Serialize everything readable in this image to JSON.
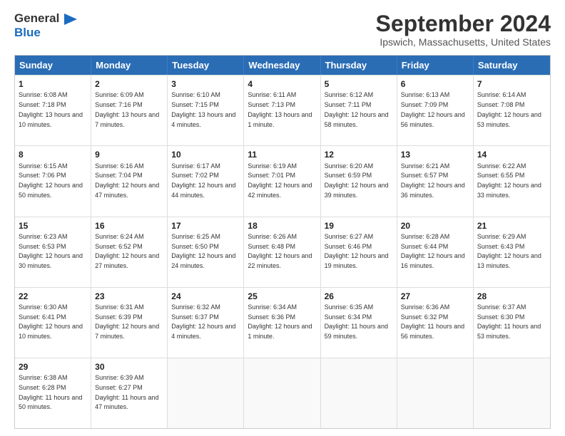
{
  "logo": {
    "line1": "General",
    "line2": "Blue"
  },
  "title": "September 2024",
  "subtitle": "Ipswich, Massachusetts, United States",
  "days": [
    "Sunday",
    "Monday",
    "Tuesday",
    "Wednesday",
    "Thursday",
    "Friday",
    "Saturday"
  ],
  "weeks": [
    [
      {
        "day": "1",
        "sunrise": "6:08 AM",
        "sunset": "7:18 PM",
        "daylight": "13 hours and 10 minutes."
      },
      {
        "day": "2",
        "sunrise": "6:09 AM",
        "sunset": "7:16 PM",
        "daylight": "13 hours and 7 minutes."
      },
      {
        "day": "3",
        "sunrise": "6:10 AM",
        "sunset": "7:15 PM",
        "daylight": "13 hours and 4 minutes."
      },
      {
        "day": "4",
        "sunrise": "6:11 AM",
        "sunset": "7:13 PM",
        "daylight": "13 hours and 1 minute."
      },
      {
        "day": "5",
        "sunrise": "6:12 AM",
        "sunset": "7:11 PM",
        "daylight": "12 hours and 58 minutes."
      },
      {
        "day": "6",
        "sunrise": "6:13 AM",
        "sunset": "7:09 PM",
        "daylight": "12 hours and 56 minutes."
      },
      {
        "day": "7",
        "sunrise": "6:14 AM",
        "sunset": "7:08 PM",
        "daylight": "12 hours and 53 minutes."
      }
    ],
    [
      {
        "day": "8",
        "sunrise": "6:15 AM",
        "sunset": "7:06 PM",
        "daylight": "12 hours and 50 minutes."
      },
      {
        "day": "9",
        "sunrise": "6:16 AM",
        "sunset": "7:04 PM",
        "daylight": "12 hours and 47 minutes."
      },
      {
        "day": "10",
        "sunrise": "6:17 AM",
        "sunset": "7:02 PM",
        "daylight": "12 hours and 44 minutes."
      },
      {
        "day": "11",
        "sunrise": "6:19 AM",
        "sunset": "7:01 PM",
        "daylight": "12 hours and 42 minutes."
      },
      {
        "day": "12",
        "sunrise": "6:20 AM",
        "sunset": "6:59 PM",
        "daylight": "12 hours and 39 minutes."
      },
      {
        "day": "13",
        "sunrise": "6:21 AM",
        "sunset": "6:57 PM",
        "daylight": "12 hours and 36 minutes."
      },
      {
        "day": "14",
        "sunrise": "6:22 AM",
        "sunset": "6:55 PM",
        "daylight": "12 hours and 33 minutes."
      }
    ],
    [
      {
        "day": "15",
        "sunrise": "6:23 AM",
        "sunset": "6:53 PM",
        "daylight": "12 hours and 30 minutes."
      },
      {
        "day": "16",
        "sunrise": "6:24 AM",
        "sunset": "6:52 PM",
        "daylight": "12 hours and 27 minutes."
      },
      {
        "day": "17",
        "sunrise": "6:25 AM",
        "sunset": "6:50 PM",
        "daylight": "12 hours and 24 minutes."
      },
      {
        "day": "18",
        "sunrise": "6:26 AM",
        "sunset": "6:48 PM",
        "daylight": "12 hours and 22 minutes."
      },
      {
        "day": "19",
        "sunrise": "6:27 AM",
        "sunset": "6:46 PM",
        "daylight": "12 hours and 19 minutes."
      },
      {
        "day": "20",
        "sunrise": "6:28 AM",
        "sunset": "6:44 PM",
        "daylight": "12 hours and 16 minutes."
      },
      {
        "day": "21",
        "sunrise": "6:29 AM",
        "sunset": "6:43 PM",
        "daylight": "12 hours and 13 minutes."
      }
    ],
    [
      {
        "day": "22",
        "sunrise": "6:30 AM",
        "sunset": "6:41 PM",
        "daylight": "12 hours and 10 minutes."
      },
      {
        "day": "23",
        "sunrise": "6:31 AM",
        "sunset": "6:39 PM",
        "daylight": "12 hours and 7 minutes."
      },
      {
        "day": "24",
        "sunrise": "6:32 AM",
        "sunset": "6:37 PM",
        "daylight": "12 hours and 4 minutes."
      },
      {
        "day": "25",
        "sunrise": "6:34 AM",
        "sunset": "6:36 PM",
        "daylight": "12 hours and 1 minute."
      },
      {
        "day": "26",
        "sunrise": "6:35 AM",
        "sunset": "6:34 PM",
        "daylight": "11 hours and 59 minutes."
      },
      {
        "day": "27",
        "sunrise": "6:36 AM",
        "sunset": "6:32 PM",
        "daylight": "11 hours and 56 minutes."
      },
      {
        "day": "28",
        "sunrise": "6:37 AM",
        "sunset": "6:30 PM",
        "daylight": "11 hours and 53 minutes."
      }
    ],
    [
      {
        "day": "29",
        "sunrise": "6:38 AM",
        "sunset": "6:28 PM",
        "daylight": "11 hours and 50 minutes."
      },
      {
        "day": "30",
        "sunrise": "6:39 AM",
        "sunset": "6:27 PM",
        "daylight": "11 hours and 47 minutes."
      },
      null,
      null,
      null,
      null,
      null
    ]
  ]
}
